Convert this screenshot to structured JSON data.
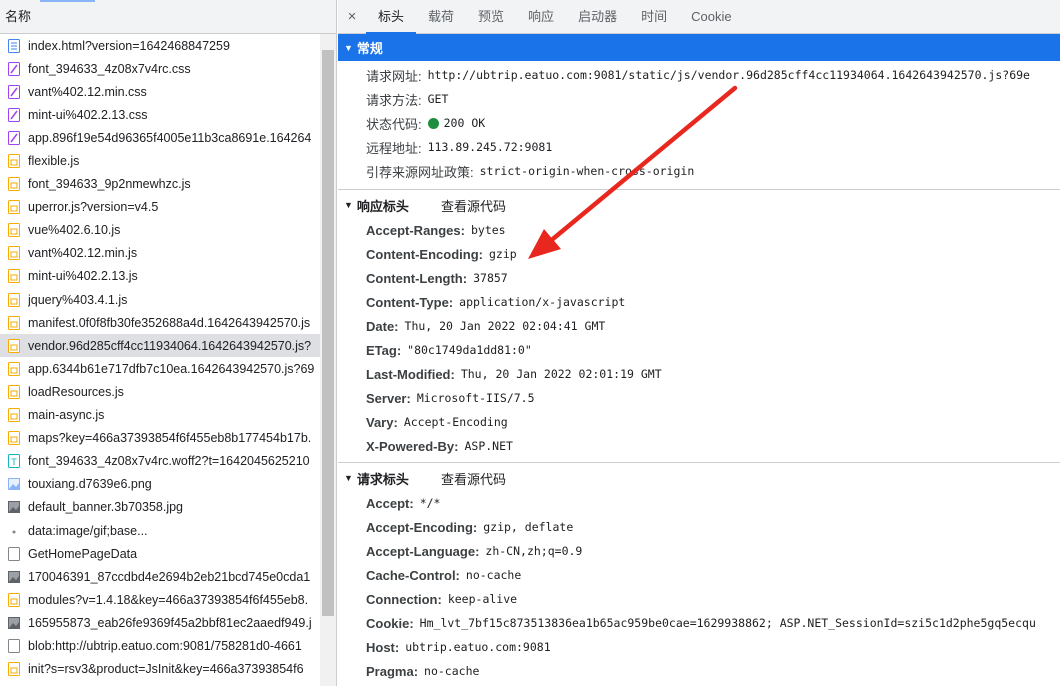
{
  "left_panel": {
    "header": "名称",
    "files": [
      {
        "name": "index.html?version=1642468847259",
        "type": "doc"
      },
      {
        "name": "font_394633_4z08x7v4rc.css",
        "type": "css"
      },
      {
        "name": "vant%402.12.min.css",
        "type": "css"
      },
      {
        "name": "mint-ui%402.2.13.css",
        "type": "css"
      },
      {
        "name": "app.896f19e54d96365f4005e11b3ca8691e.164264",
        "type": "css"
      },
      {
        "name": "flexible.js",
        "type": "js"
      },
      {
        "name": "font_394633_9p2nmewhzc.js",
        "type": "js"
      },
      {
        "name": "uperror.js?version=v4.5",
        "type": "js"
      },
      {
        "name": "vue%402.6.10.js",
        "type": "js"
      },
      {
        "name": "vant%402.12.min.js",
        "type": "js"
      },
      {
        "name": "mint-ui%402.2.13.js",
        "type": "js"
      },
      {
        "name": "jquery%403.4.1.js",
        "type": "js"
      },
      {
        "name": "manifest.0f0f8fb30fe352688a4d.1642643942570.js",
        "type": "js"
      },
      {
        "name": "vendor.96d285cff4cc11934064.1642643942570.js?",
        "type": "js",
        "selected": true
      },
      {
        "name": "app.6344b61e717dfb7c10ea.1642643942570.js?69",
        "type": "js"
      },
      {
        "name": "loadResources.js",
        "type": "js"
      },
      {
        "name": "main-async.js",
        "type": "js"
      },
      {
        "name": "maps?key=466a37393854f6f455eb8b177454b17b.",
        "type": "js"
      },
      {
        "name": "font_394633_4z08x7v4rc.woff2?t=1642045625210",
        "type": "font"
      },
      {
        "name": "touxiang.d7639e6.png",
        "type": "img"
      },
      {
        "name": "default_banner.3b70358.jpg",
        "type": "imgdark"
      },
      {
        "name": "data:image/gif;base...",
        "type": "dot"
      },
      {
        "name": "GetHomePageData",
        "type": "blank"
      },
      {
        "name": "170046391_87ccdbd4e2694b2eb21bcd745e0cda1",
        "type": "imgdark"
      },
      {
        "name": "modules?v=1.4.18&key=466a37393854f6f455eb8.",
        "type": "js"
      },
      {
        "name": "165955873_eab26fe9369f45a2bbf81ec2aaedf949.j",
        "type": "imgdark"
      },
      {
        "name": "blob:http://ubtrip.eatuo.com:9081/758281d0-4661",
        "type": "blank"
      },
      {
        "name": "init?s=rsv3&product=JsInit&key=466a37393854f6",
        "type": "js"
      }
    ]
  },
  "tabs": [
    "标头",
    "载荷",
    "预览",
    "响应",
    "启动器",
    "时间",
    "Cookie"
  ],
  "close_symbol": "×",
  "general": {
    "title": "常规",
    "rows": [
      {
        "k": "请求网址:",
        "v": "http://ubtrip.eatuo.com:9081/static/js/vendor.96d285cff4cc11934064.1642643942570.js?69e"
      },
      {
        "k": "请求方法:",
        "v": "GET"
      },
      {
        "k": "状态代码:",
        "v": "200 OK",
        "status_dot": true
      },
      {
        "k": "远程地址:",
        "v": "113.89.245.72:9081"
      },
      {
        "k": "引荐来源网址政策:",
        "v": "strict-origin-when-cross-origin"
      }
    ]
  },
  "response_headers": {
    "title": "响应标头",
    "view_source": "查看源代码",
    "rows": [
      {
        "k": "Accept-Ranges:",
        "v": "bytes"
      },
      {
        "k": "Content-Encoding:",
        "v": "gzip"
      },
      {
        "k": "Content-Length:",
        "v": "37857"
      },
      {
        "k": "Content-Type:",
        "v": "application/x-javascript"
      },
      {
        "k": "Date:",
        "v": "Thu, 20 Jan 2022 02:04:41 GMT"
      },
      {
        "k": "ETag:",
        "v": "\"80c1749da1dd81:0\""
      },
      {
        "k": "Last-Modified:",
        "v": "Thu, 20 Jan 2022 02:01:19 GMT"
      },
      {
        "k": "Server:",
        "v": "Microsoft-IIS/7.5"
      },
      {
        "k": "Vary:",
        "v": "Accept-Encoding"
      },
      {
        "k": "X-Powered-By:",
        "v": "ASP.NET"
      }
    ]
  },
  "request_headers": {
    "title": "请求标头",
    "view_source": "查看源代码",
    "rows": [
      {
        "k": "Accept:",
        "v": "*/*"
      },
      {
        "k": "Accept-Encoding:",
        "v": "gzip, deflate"
      },
      {
        "k": "Accept-Language:",
        "v": "zh-CN,zh;q=0.9"
      },
      {
        "k": "Cache-Control:",
        "v": "no-cache"
      },
      {
        "k": "Connection:",
        "v": "keep-alive"
      },
      {
        "k": "Cookie:",
        "v": "Hm_lvt_7bf15c873513836ea1b65ac959be0cae=1629938862; ASP.NET_SessionId=szi5c1d2phe5gq5ecqu"
      },
      {
        "k": "Host:",
        "v": "ubtrip.eatuo.com:9081"
      },
      {
        "k": "Pragma:",
        "v": "no-cache"
      }
    ]
  },
  "colors": {
    "accent": "#1a73e8",
    "status_ok": "#1e8e3e",
    "annotation_arrow": "#e8281e",
    "selected_row": "#dedfe3"
  }
}
